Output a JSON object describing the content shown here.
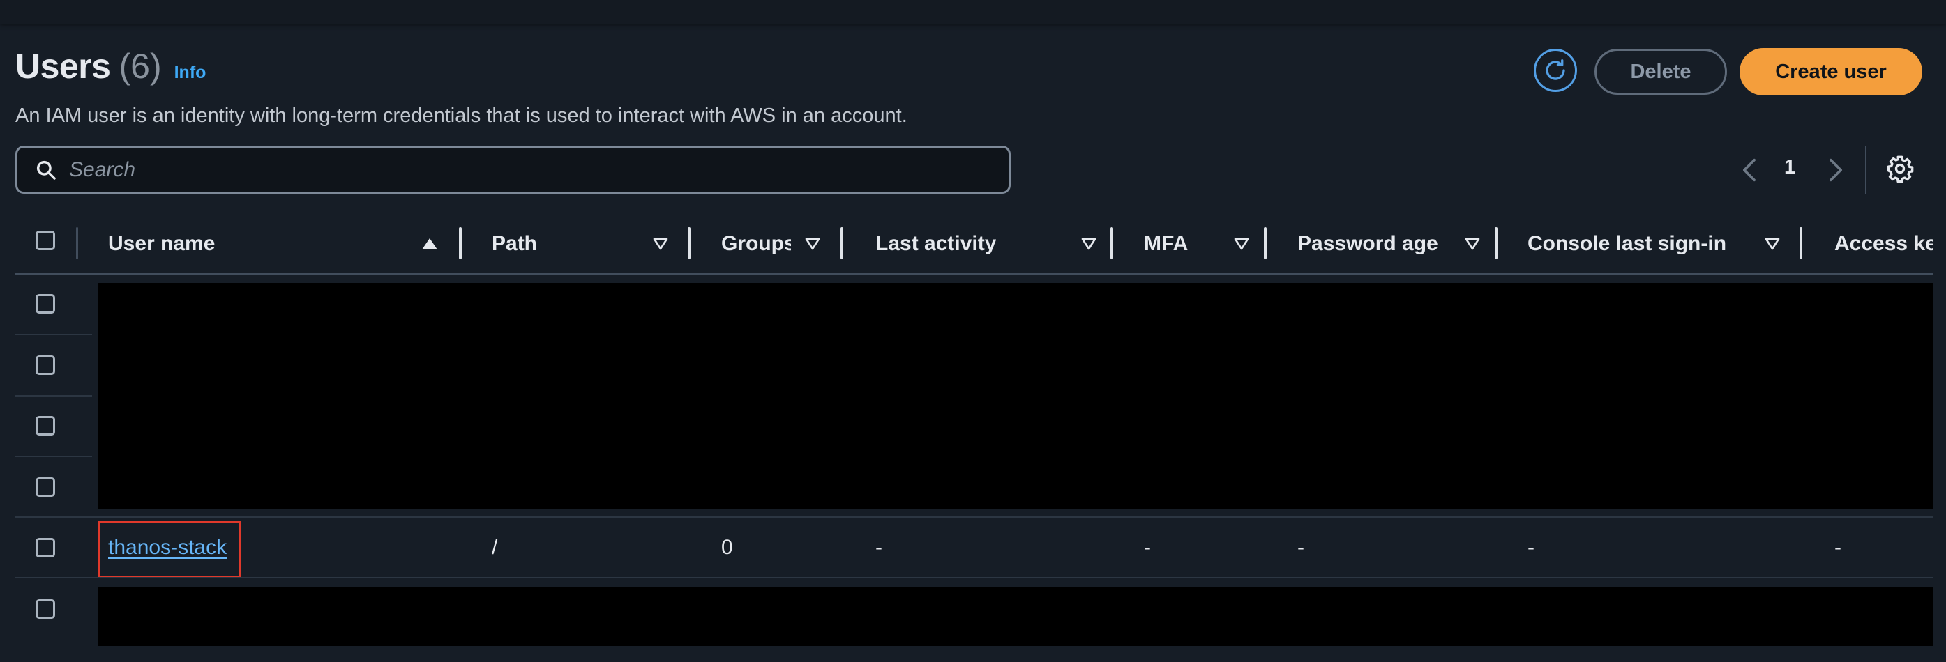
{
  "header": {
    "title": "Users",
    "count": "(6)",
    "info_label": "Info",
    "description": "An IAM user is an identity with long-term credentials that is used to interact with AWS in an account."
  },
  "actions": {
    "refresh_icon": "refresh-icon",
    "delete_label": "Delete",
    "create_label": "Create user"
  },
  "search": {
    "placeholder": "Search",
    "value": ""
  },
  "pagination": {
    "current_page": "1"
  },
  "table": {
    "columns": [
      {
        "label": "User name",
        "sort": "ascending"
      },
      {
        "label": "Path",
        "sort": "none"
      },
      {
        "label": "Groups",
        "sort": "none"
      },
      {
        "label": "Last activity",
        "sort": "none"
      },
      {
        "label": "MFA",
        "sort": "none"
      },
      {
        "label": "Password age",
        "sort": "none"
      },
      {
        "label": "Console last sign-in",
        "sort": "none"
      },
      {
        "label": "Access key ID",
        "sort": "none"
      }
    ],
    "visible_row": {
      "user_name": "thanos-stack",
      "path": "/",
      "groups": "0",
      "last_activity": "-",
      "mfa": "-",
      "password_age": "-",
      "console_last_sign_in": "-",
      "access_key_id": "-"
    }
  },
  "colors": {
    "background": "#161d26",
    "accent_orange": "#f49e3c",
    "link_blue": "#67b6f8",
    "highlight_red": "#e0392b"
  }
}
